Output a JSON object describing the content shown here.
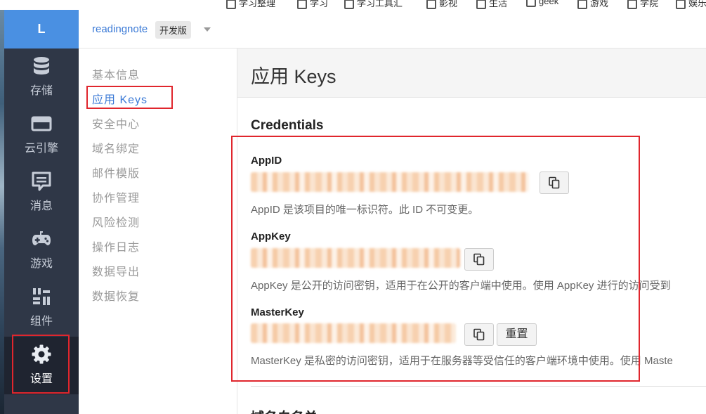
{
  "bookmarks": [
    "学习整理",
    "学习",
    "学习工具汇",
    "影视",
    "生活",
    "geek",
    "游戏",
    "学院",
    "娱乐"
  ],
  "brand": {
    "letter": "L"
  },
  "leftnav": [
    {
      "key": "storage",
      "label": "存储",
      "icon": "database-icon"
    },
    {
      "key": "engine",
      "label": "云引擎",
      "icon": "server-icon"
    },
    {
      "key": "message",
      "label": "消息",
      "icon": "message-icon"
    },
    {
      "key": "game",
      "label": "游戏",
      "icon": "gamepad-icon"
    },
    {
      "key": "components",
      "label": "组件",
      "icon": "components-icon"
    },
    {
      "key": "settings",
      "label": "设置",
      "icon": "gear-icon",
      "active": true
    }
  ],
  "header": {
    "app_name": "readingnote",
    "env_badge": "开发版"
  },
  "subnav": [
    {
      "label": "基本信息"
    },
    {
      "label": "应用 Keys",
      "active": true
    },
    {
      "label": "安全中心"
    },
    {
      "label": "域名绑定"
    },
    {
      "label": "邮件模版"
    },
    {
      "label": "协作管理"
    },
    {
      "label": "风险检测"
    },
    {
      "label": "操作日志"
    },
    {
      "label": "数据导出"
    },
    {
      "label": "数据恢复"
    }
  ],
  "page": {
    "title": "应用 Keys",
    "section_title": "Credentials",
    "appid": {
      "label": "AppID",
      "help": "AppID 是该项目的唯一标识符。此 ID 不可变更。"
    },
    "appkey": {
      "label": "AppKey",
      "help": "AppKey 是公开的访问密钥，适用于在公开的客户端中使用。使用 AppKey 进行的访问受到"
    },
    "masterkey": {
      "label": "MasterKey",
      "help": "MasterKey 是私密的访问密钥，适用于在服务器等受信任的客户端环境中使用。使用 Maste",
      "reset_label": "重置"
    },
    "next_section_title": "域名白名单"
  },
  "colors": {
    "accent": "#3b7ad6",
    "nav_bg": "#2f3747",
    "brand_bg": "#4a90e2",
    "highlight": "#e0262d"
  }
}
